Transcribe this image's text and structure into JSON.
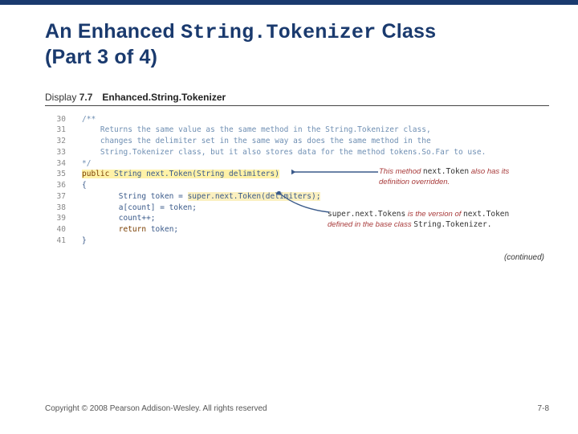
{
  "title": {
    "pre": "An Enhanced ",
    "mono": "String.Tokenizer",
    "post": " Class",
    "line2": "(Part 3 of 4)"
  },
  "display": {
    "label": "Display",
    "num": "7.7",
    "name": "Enhanced.String.Tokenizer"
  },
  "code": {
    "lines": [
      {
        "n": "30",
        "indent": 0,
        "text": "/**",
        "cls": "comment"
      },
      {
        "n": "31",
        "indent": 1,
        "text": "Returns the same value as the same method in the String.Tokenizer class,",
        "cls": "comment"
      },
      {
        "n": "32",
        "indent": 1,
        "text": "changes the delimiter set in the same way as does the same method in the",
        "cls": "comment"
      },
      {
        "n": "33",
        "indent": 1,
        "text": "String.Tokenizer class, but it also stores data for the method tokens.So.Far to use.",
        "cls": "comment"
      },
      {
        "n": "34",
        "indent": 0,
        "text": "*/",
        "cls": "comment"
      },
      {
        "n": "35",
        "indent": 0,
        "hl": "yel",
        "kw": "public",
        "text": " String next.Token(String delimiters)"
      },
      {
        "n": "36",
        "indent": 0,
        "text": "{"
      },
      {
        "n": "37",
        "indent": 2,
        "pre": "String token = ",
        "hlspan": "super.next.Token(delimiters);",
        "hl2": "ylite"
      },
      {
        "n": "38",
        "indent": 2,
        "text": "a[count] = token;"
      },
      {
        "n": "39",
        "indent": 2,
        "text": "count++;"
      },
      {
        "n": "40",
        "indent": 2,
        "kw": "return",
        "text": " token;"
      },
      {
        "n": "41",
        "indent": 0,
        "text": "}"
      }
    ]
  },
  "annot": {
    "a1": {
      "p1": "This method ",
      "c1": "next.Token",
      "p2": " also has its definition overridden."
    },
    "a2": {
      "c1": "super.next.Tokens",
      "p1": " is the version of ",
      "c2": "next.Token",
      "p2": " defined in the base class ",
      "c3": "String.Tokenizer."
    }
  },
  "continued": "(continued)",
  "footer": {
    "left": "Copyright © 2008 Pearson Addison-Wesley. All rights reserved",
    "right": "7-8"
  }
}
